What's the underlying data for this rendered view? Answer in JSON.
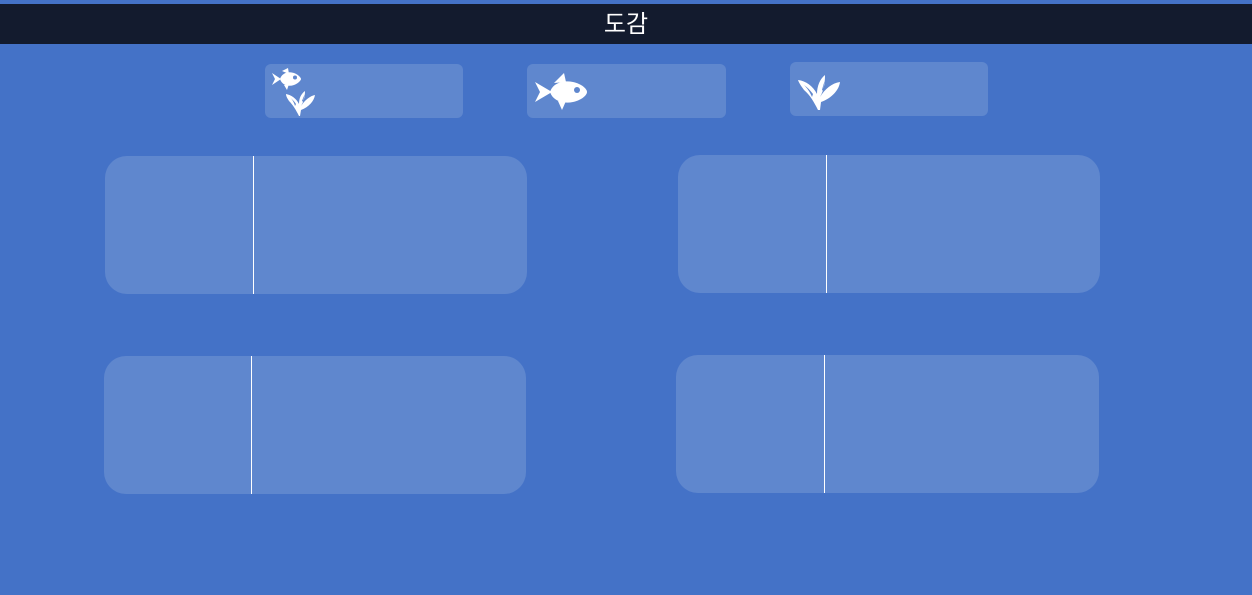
{
  "header": {
    "title": "도감"
  },
  "tabs": [
    {
      "id": "all",
      "icons": [
        "fish-icon",
        "plant-icon"
      ]
    },
    {
      "id": "fish",
      "icons": [
        "fish-icon"
      ]
    },
    {
      "id": "plants",
      "icons": [
        "plant-icon"
      ]
    }
  ],
  "colors": {
    "background": "#4472c7",
    "title_bar": "#131b2e",
    "panel": "#5f87ce",
    "icon": "#ffffff"
  }
}
